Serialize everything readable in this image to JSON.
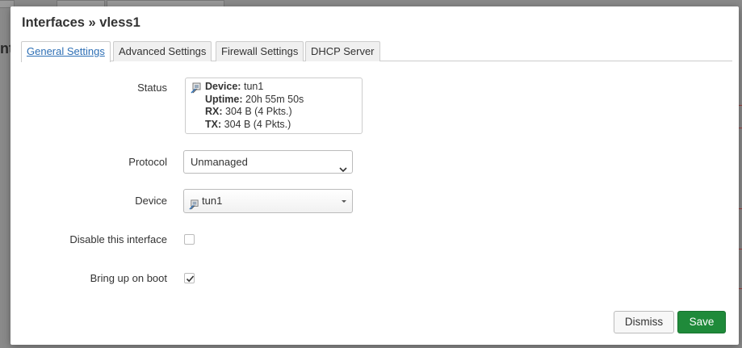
{
  "background": {
    "heading_fragment": "nt",
    "tab_fragment": "In"
  },
  "modal": {
    "title": "Interfaces » vless1",
    "tabs": [
      {
        "label": "General Settings",
        "active": true
      },
      {
        "label": "Advanced Settings",
        "active": false
      },
      {
        "label": "Firewall Settings",
        "active": false
      },
      {
        "label": "DHCP Server",
        "active": false
      }
    ],
    "status": {
      "label": "Status",
      "device_key": "Device:",
      "device_val": "tun1",
      "uptime_key": "Uptime:",
      "uptime_val": "20h 55m 50s",
      "rx_key": "RX:",
      "rx_val": "304 B (4 Pkts.)",
      "tx_key": "TX:",
      "tx_val": "304 B (4 Pkts.)",
      "icon": "network-port-icon"
    },
    "protocol": {
      "label": "Protocol",
      "value": "Unmanaged"
    },
    "device": {
      "label": "Device",
      "value": "tun1",
      "icon": "network-port-icon"
    },
    "disable": {
      "label": "Disable this interface",
      "checked": false
    },
    "boot": {
      "label": "Bring up on boot",
      "checked": true
    },
    "buttons": {
      "dismiss": "Dismiss",
      "save": "Save"
    }
  },
  "colors": {
    "accent_link": "#2e6fb5",
    "save_green": "#1f8a3a"
  }
}
